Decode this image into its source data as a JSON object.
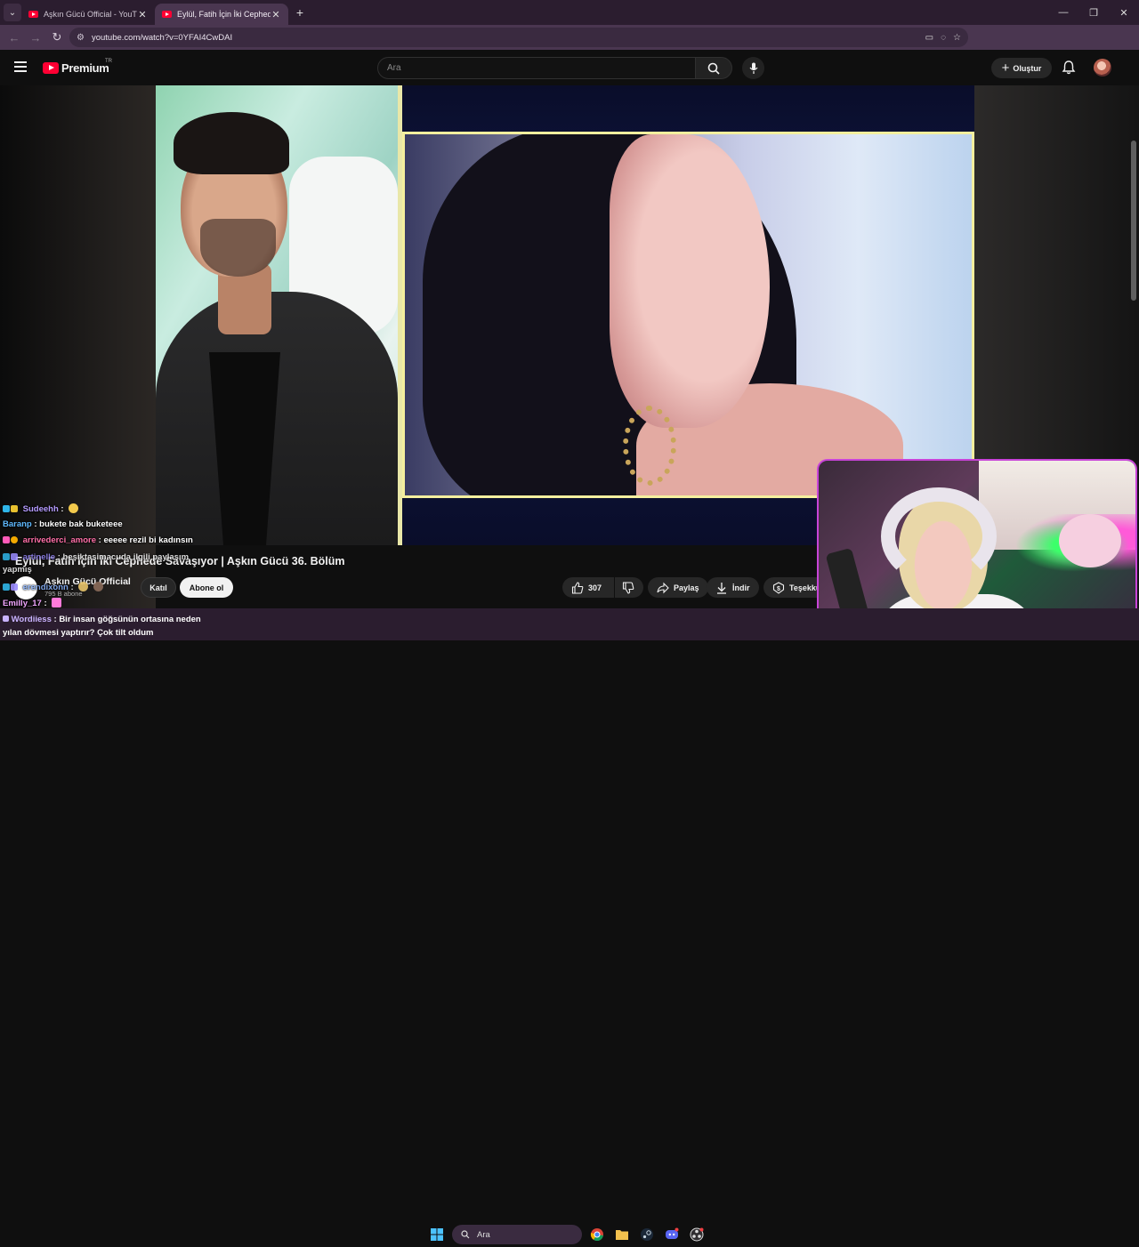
{
  "browser": {
    "tabs": [
      {
        "label": "Aşkın Gücü Official - YouTube",
        "active": false
      },
      {
        "label": "Eylül, Fatih İçin İki Cephede Savaşıyor",
        "active": true
      }
    ],
    "url": "youtube.com/watch?v=0YFAI4CwDAI"
  },
  "youtube": {
    "logo_text": "Premium",
    "region": "TR",
    "search_placeholder": "Ara",
    "create_label": "Oluştur"
  },
  "video": {
    "title": "Eylül, Fatih İçin İki Cephede Savaşıyor | Aşkın Gücü 36. Bölüm",
    "channel": "Aşkın Gücü Official",
    "subscribers": "795 B abone",
    "join_label": "Katıl",
    "subscribe_label": "Abone ol",
    "likes": "307",
    "share_label": "Paylaş",
    "download_label": "İndir",
    "thanks_label": "Teşekkü"
  },
  "chat": [
    {
      "user": "Sudeehh",
      "message": ":",
      "user_color": "#b59bff"
    },
    {
      "user": "Baranp",
      "message": ": bukete bak buketeee",
      "user_color": "#5fb9ff"
    },
    {
      "user": "arrivederci_amore",
      "message": ": eeeee rezil bi kadınsın",
      "user_color": "#ff6fa8"
    },
    {
      "user": "artinelle",
      "message": ": beşiktasimacuda ilgili paylaşım yapmış",
      "user_color": "#9b8cff"
    },
    {
      "user": "erendixonn",
      "message": ":",
      "user_color": "#8ab4ff"
    },
    {
      "user": "Emilly_17",
      "message": ":",
      "user_color": "#f1a6ff"
    },
    {
      "user": "Wordiiess",
      "message": ": Bir insan göğsünün ortasına neden yılan dövmesi yaptırır? Çok tilt oldum",
      "user_color": "#c9b3ff"
    }
  ],
  "taskbar": {
    "search_label": "Ara"
  }
}
